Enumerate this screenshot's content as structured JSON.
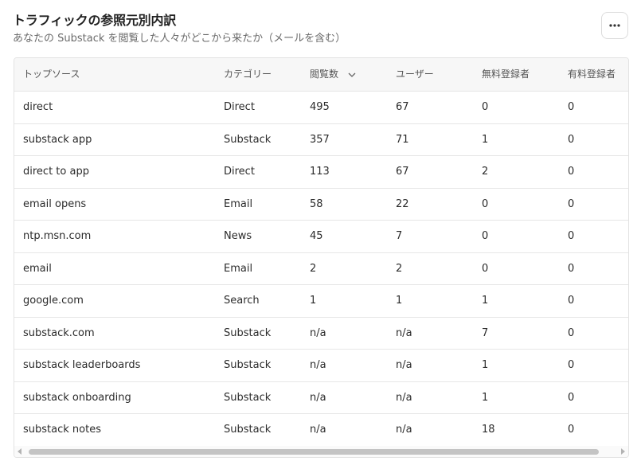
{
  "header": {
    "title": "トラフィックの参照元別内訳",
    "subtitle": "あなたの Substack を閲覧した人々がどこから来たか（メールを含む）",
    "more_icon": "more-horizontal-icon"
  },
  "table": {
    "columns": [
      "トップソース",
      "カテゴリー",
      "閲覧数",
      "ユーザー",
      "無料登録者",
      "有料登録者"
    ],
    "sort_icon": "chevron-down-icon",
    "rows": [
      [
        "direct",
        "Direct",
        "495",
        "67",
        "0",
        "0"
      ],
      [
        "substack app",
        "Substack",
        "357",
        "71",
        "1",
        "0"
      ],
      [
        "direct to app",
        "Direct",
        "113",
        "67",
        "2",
        "0"
      ],
      [
        "email opens",
        "Email",
        "58",
        "22",
        "0",
        "0"
      ],
      [
        "ntp.msn.com",
        "News",
        "45",
        "7",
        "0",
        "0"
      ],
      [
        "email",
        "Email",
        "2",
        "2",
        "0",
        "0"
      ],
      [
        "google.com",
        "Search",
        "1",
        "1",
        "1",
        "0"
      ],
      [
        "substack.com",
        "Substack",
        "n/a",
        "n/a",
        "7",
        "0"
      ],
      [
        "substack leaderboards",
        "Substack",
        "n/a",
        "n/a",
        "1",
        "0"
      ],
      [
        "substack onboarding",
        "Substack",
        "n/a",
        "n/a",
        "1",
        "0"
      ],
      [
        "substack notes",
        "Substack",
        "n/a",
        "n/a",
        "18",
        "0"
      ]
    ]
  }
}
